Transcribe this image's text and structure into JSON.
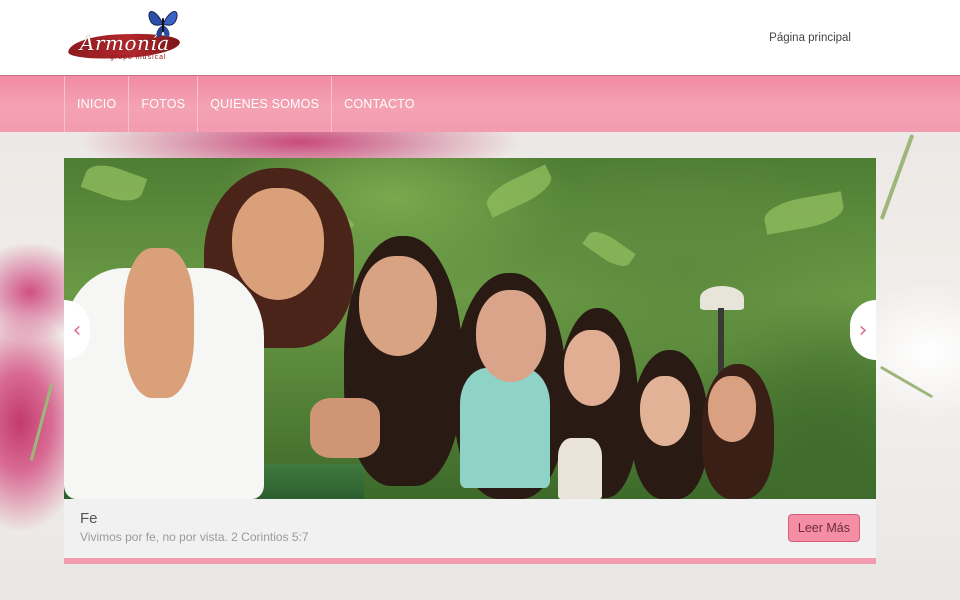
{
  "header": {
    "logo_text": "Armonía",
    "logo_subtext": "grupo musical",
    "home_link": "Página principal"
  },
  "nav": {
    "items": [
      {
        "label": "INICIO"
      },
      {
        "label": "FOTOS"
      },
      {
        "label": "QUIENES SOMOS"
      },
      {
        "label": "CONTACTO"
      }
    ]
  },
  "slider": {
    "prev_icon": "chevron-left-icon",
    "next_icon": "chevron-right-icon",
    "caption_title": "Fe",
    "caption_text": "Vivimos por fe, no por vista. 2 Corintios 5:7",
    "read_more_label": "Leer Más"
  },
  "colors": {
    "nav_pink": "#f4a2b4",
    "button_pink": "#f58ea5",
    "logo_red": "#8d1a1f"
  }
}
